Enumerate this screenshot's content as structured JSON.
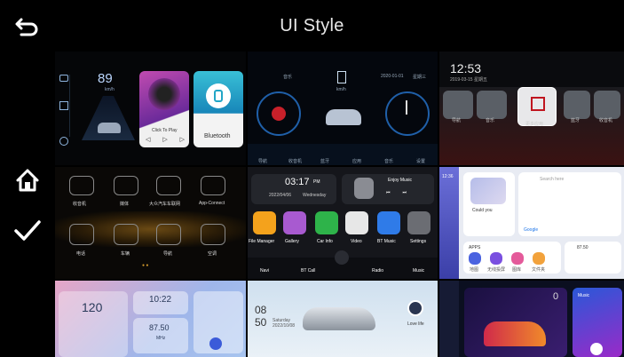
{
  "header": {
    "title": "UI Style"
  },
  "sidebar": {
    "back_icon": "back-arrow-icon",
    "home_icon": "home-icon",
    "confirm_icon": "checkmark-icon"
  },
  "styles": {
    "s1": {
      "speed": "89",
      "unit": "km/h",
      "play_label": "Click To Play",
      "bt_label": "Bluetooth"
    },
    "s2": {
      "label_music": "音乐",
      "unit": "km/h",
      "date": "2020-01-01",
      "weekday": "星期三",
      "nav": [
        "导航",
        "收音机",
        "蓝牙",
        "应用",
        "音乐",
        "设置"
      ]
    },
    "s3": {
      "time": "12:53",
      "date": "2019-03-15  星期五",
      "apps": [
        "导航",
        "音乐",
        "更多应用",
        "蓝牙",
        "收音机"
      ]
    },
    "s4": {
      "top_row": [
        "收音机",
        "媒体",
        "大众汽车车联网",
        "App-Connect"
      ],
      "bottom_row": [
        "电话",
        "车辆",
        "导航",
        "空调"
      ]
    },
    "s5": {
      "time": "03:17",
      "ampm": "PM",
      "date": "2022/04/06",
      "weekday": "Wednesday",
      "music": "Enjoy Music",
      "apps": [
        "File Manager",
        "Gallery",
        "Car Info",
        "Video",
        "BT Music",
        "Settings"
      ],
      "bottom": [
        "Navi",
        "BT Call",
        "Radio",
        "Music"
      ]
    },
    "s6": {
      "clock": "12:36",
      "song": "Could you",
      "search_placeholder": "Search here",
      "map_brand": "Google",
      "apps_label": "APPS",
      "radio_freq": "87.50",
      "apps": [
        "地图",
        "无线投屏",
        "图库",
        "文件夹"
      ]
    },
    "s7": {
      "speed": "120",
      "time": "10:22",
      "freq": "87.50",
      "unit": "MHz"
    },
    "s8": {
      "hour": "08",
      "minute": "50",
      "weekday": "Saturday",
      "date": "2022/10/08",
      "song": "Love life"
    },
    "s9": {
      "speed": "0",
      "label": "Music"
    }
  }
}
